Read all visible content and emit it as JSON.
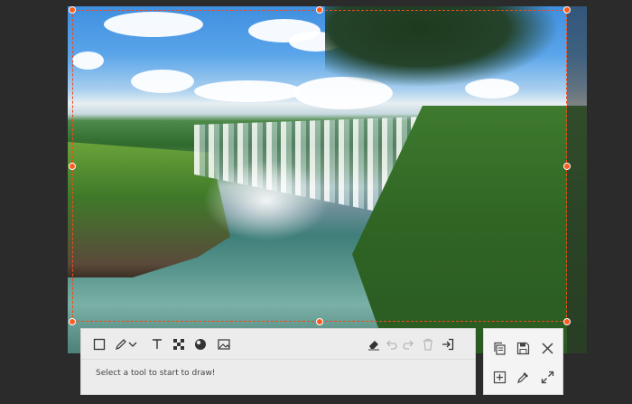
{
  "screenshot": {
    "selection_color": "#f04a1a",
    "handles": [
      "top-left",
      "top-center",
      "top-right",
      "middle-left",
      "middle-right",
      "bottom-left",
      "bottom-center",
      "bottom-right"
    ]
  },
  "toolbar": {
    "tools": [
      {
        "name": "rectangle-tool",
        "icon": "square-icon"
      },
      {
        "name": "pen-tool",
        "icon": "pen-icon"
      },
      {
        "name": "pen-options-dropdown",
        "icon": "chevron-down-icon"
      },
      {
        "name": "text-tool",
        "icon": "text-icon"
      },
      {
        "name": "mosaic-tool",
        "icon": "mosaic-icon"
      },
      {
        "name": "blur-tool",
        "icon": "blur-icon"
      },
      {
        "name": "image-tool",
        "icon": "image-icon"
      }
    ],
    "edit_actions": [
      {
        "name": "eraser-button",
        "icon": "eraser-icon",
        "enabled": true
      },
      {
        "name": "undo-button",
        "icon": "undo-icon",
        "enabled": false
      },
      {
        "name": "redo-button",
        "icon": "redo-icon",
        "enabled": false
      },
      {
        "name": "delete-button",
        "icon": "trash-icon",
        "enabled": false
      },
      {
        "name": "exit-button",
        "icon": "exit-icon",
        "enabled": true
      }
    ],
    "status_text": "Select a tool to start to draw!"
  },
  "actions": [
    {
      "name": "copy-button",
      "icon": "copy-icon"
    },
    {
      "name": "save-button",
      "icon": "save-icon"
    },
    {
      "name": "close-button",
      "icon": "close-icon"
    },
    {
      "name": "pin-to-screen-button",
      "icon": "pin-add-icon"
    },
    {
      "name": "color-picker-button",
      "icon": "eyedropper-icon"
    },
    {
      "name": "fullscreen-button",
      "icon": "expand-icon"
    }
  ]
}
